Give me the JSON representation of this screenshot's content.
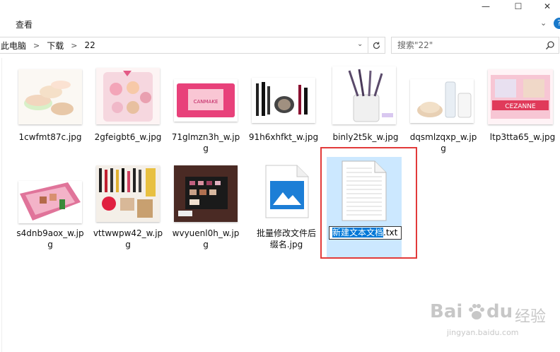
{
  "window": {
    "minimize": "—",
    "maximize": "☐",
    "close": "✕"
  },
  "ribbon": {
    "view_tab": "查看",
    "expand": "⌄",
    "help": "?"
  },
  "address": {
    "crumbs": [
      "此电脑",
      "下载",
      "22"
    ],
    "search_placeholder": "搜索\"22\""
  },
  "files": [
    {
      "name_line1": "1cwfmt87c.jpg",
      "name_line2": ""
    },
    {
      "name_line1": "2gfeigbt6_w.jpg",
      "name_line2": ""
    },
    {
      "name_line1": "71glmzn3h_w.jp",
      "name_line2": "g"
    },
    {
      "name_line1": "91h6xhfkt_w.jpg",
      "name_line2": ""
    },
    {
      "name_line1": "binly2t5k_w.jpg",
      "name_line2": ""
    },
    {
      "name_line1": "dqsmlzqxp_w.jp",
      "name_line2": "g"
    },
    {
      "name_line1": "ltp3tta65_w.jpg",
      "name_line2": ""
    },
    {
      "name_line1": "s4dnb9aox_w.jp",
      "name_line2": "g"
    },
    {
      "name_line1": "vttwwpw42_w.jp",
      "name_line2": "g"
    },
    {
      "name_line1": "wvyuenl0h_w.jp",
      "name_line2": "g"
    },
    {
      "name_line1": "批量修改文件后",
      "name_line2": "缀名.jpg"
    }
  ],
  "new_file": {
    "selected_part": "新建文本文档",
    "extension": ".txt"
  },
  "thumb_texts": {
    "canmake": "CANMAKE",
    "cezanne": "CEZANNE"
  },
  "watermark": {
    "brand": "Bai",
    "brand2": "du",
    "cn": "经验",
    "url": "jingyan.baidu.com"
  }
}
